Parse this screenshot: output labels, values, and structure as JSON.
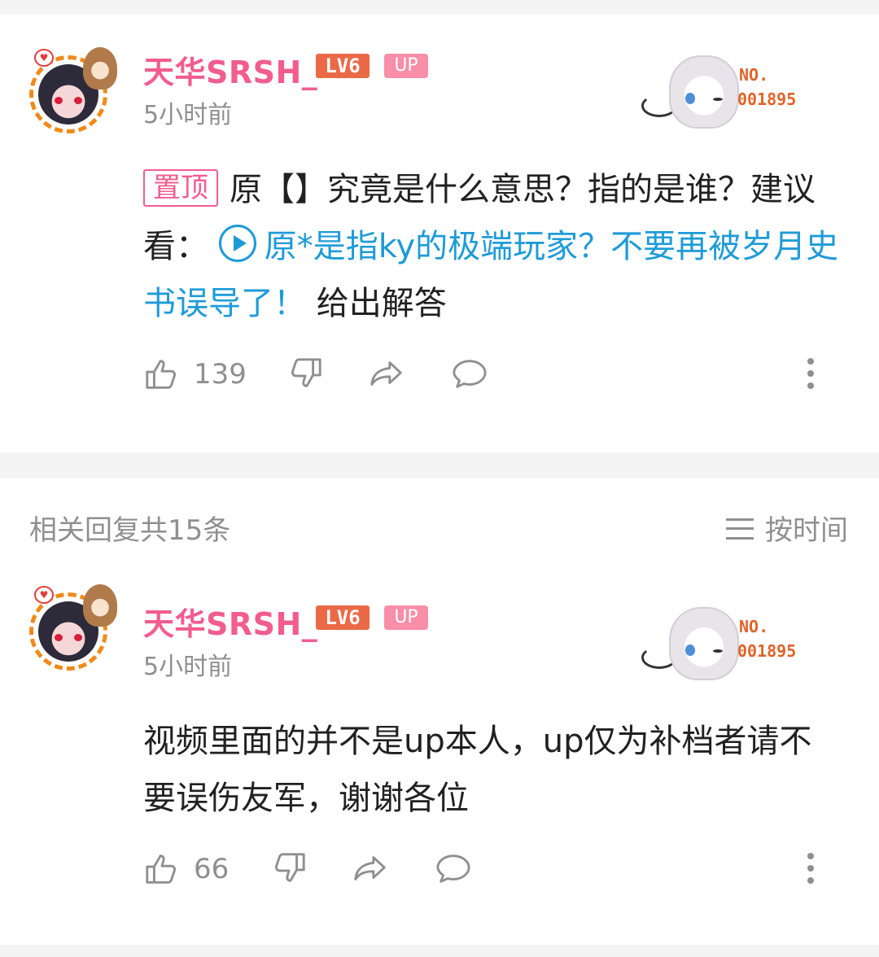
{
  "pinned_comment": {
    "username": "天华SRSH_",
    "level_badge": "LV6",
    "up_badge": "UP",
    "time": "5小时前",
    "fan_card": {
      "label": "NO.",
      "number": "001895"
    },
    "pin_label": "置顶",
    "text_intro": "原【】究竟是什么意思？指的是谁？建议看：",
    "video_link_text": "原*是指ky的极端玩家？不要再被岁月史书误导了！",
    "text_after_link": " 给出解答",
    "like_count": "139"
  },
  "replies_header": {
    "title": "相关回复共15条",
    "sort_label": "按时间"
  },
  "reply_comment": {
    "username": "天华SRSH_",
    "level_badge": "LV6",
    "up_badge": "UP",
    "time": "5小时前",
    "fan_card": {
      "label": "NO.",
      "number": "001895"
    },
    "text": "视频里面的并不是up本人，up仅为补档者请不要误伤友军，谢谢各位",
    "like_count": "66"
  },
  "icons": [
    "like-icon",
    "dislike-icon",
    "share-icon",
    "reply-icon",
    "more-icon",
    "play-circle-icon",
    "sort-icon"
  ],
  "colors": {
    "username": "#f25d8e",
    "link": "#1e9bd7",
    "level_badge": "#ea6a48",
    "up_badge": "#f88ea8",
    "muted": "#8f8f8f"
  }
}
